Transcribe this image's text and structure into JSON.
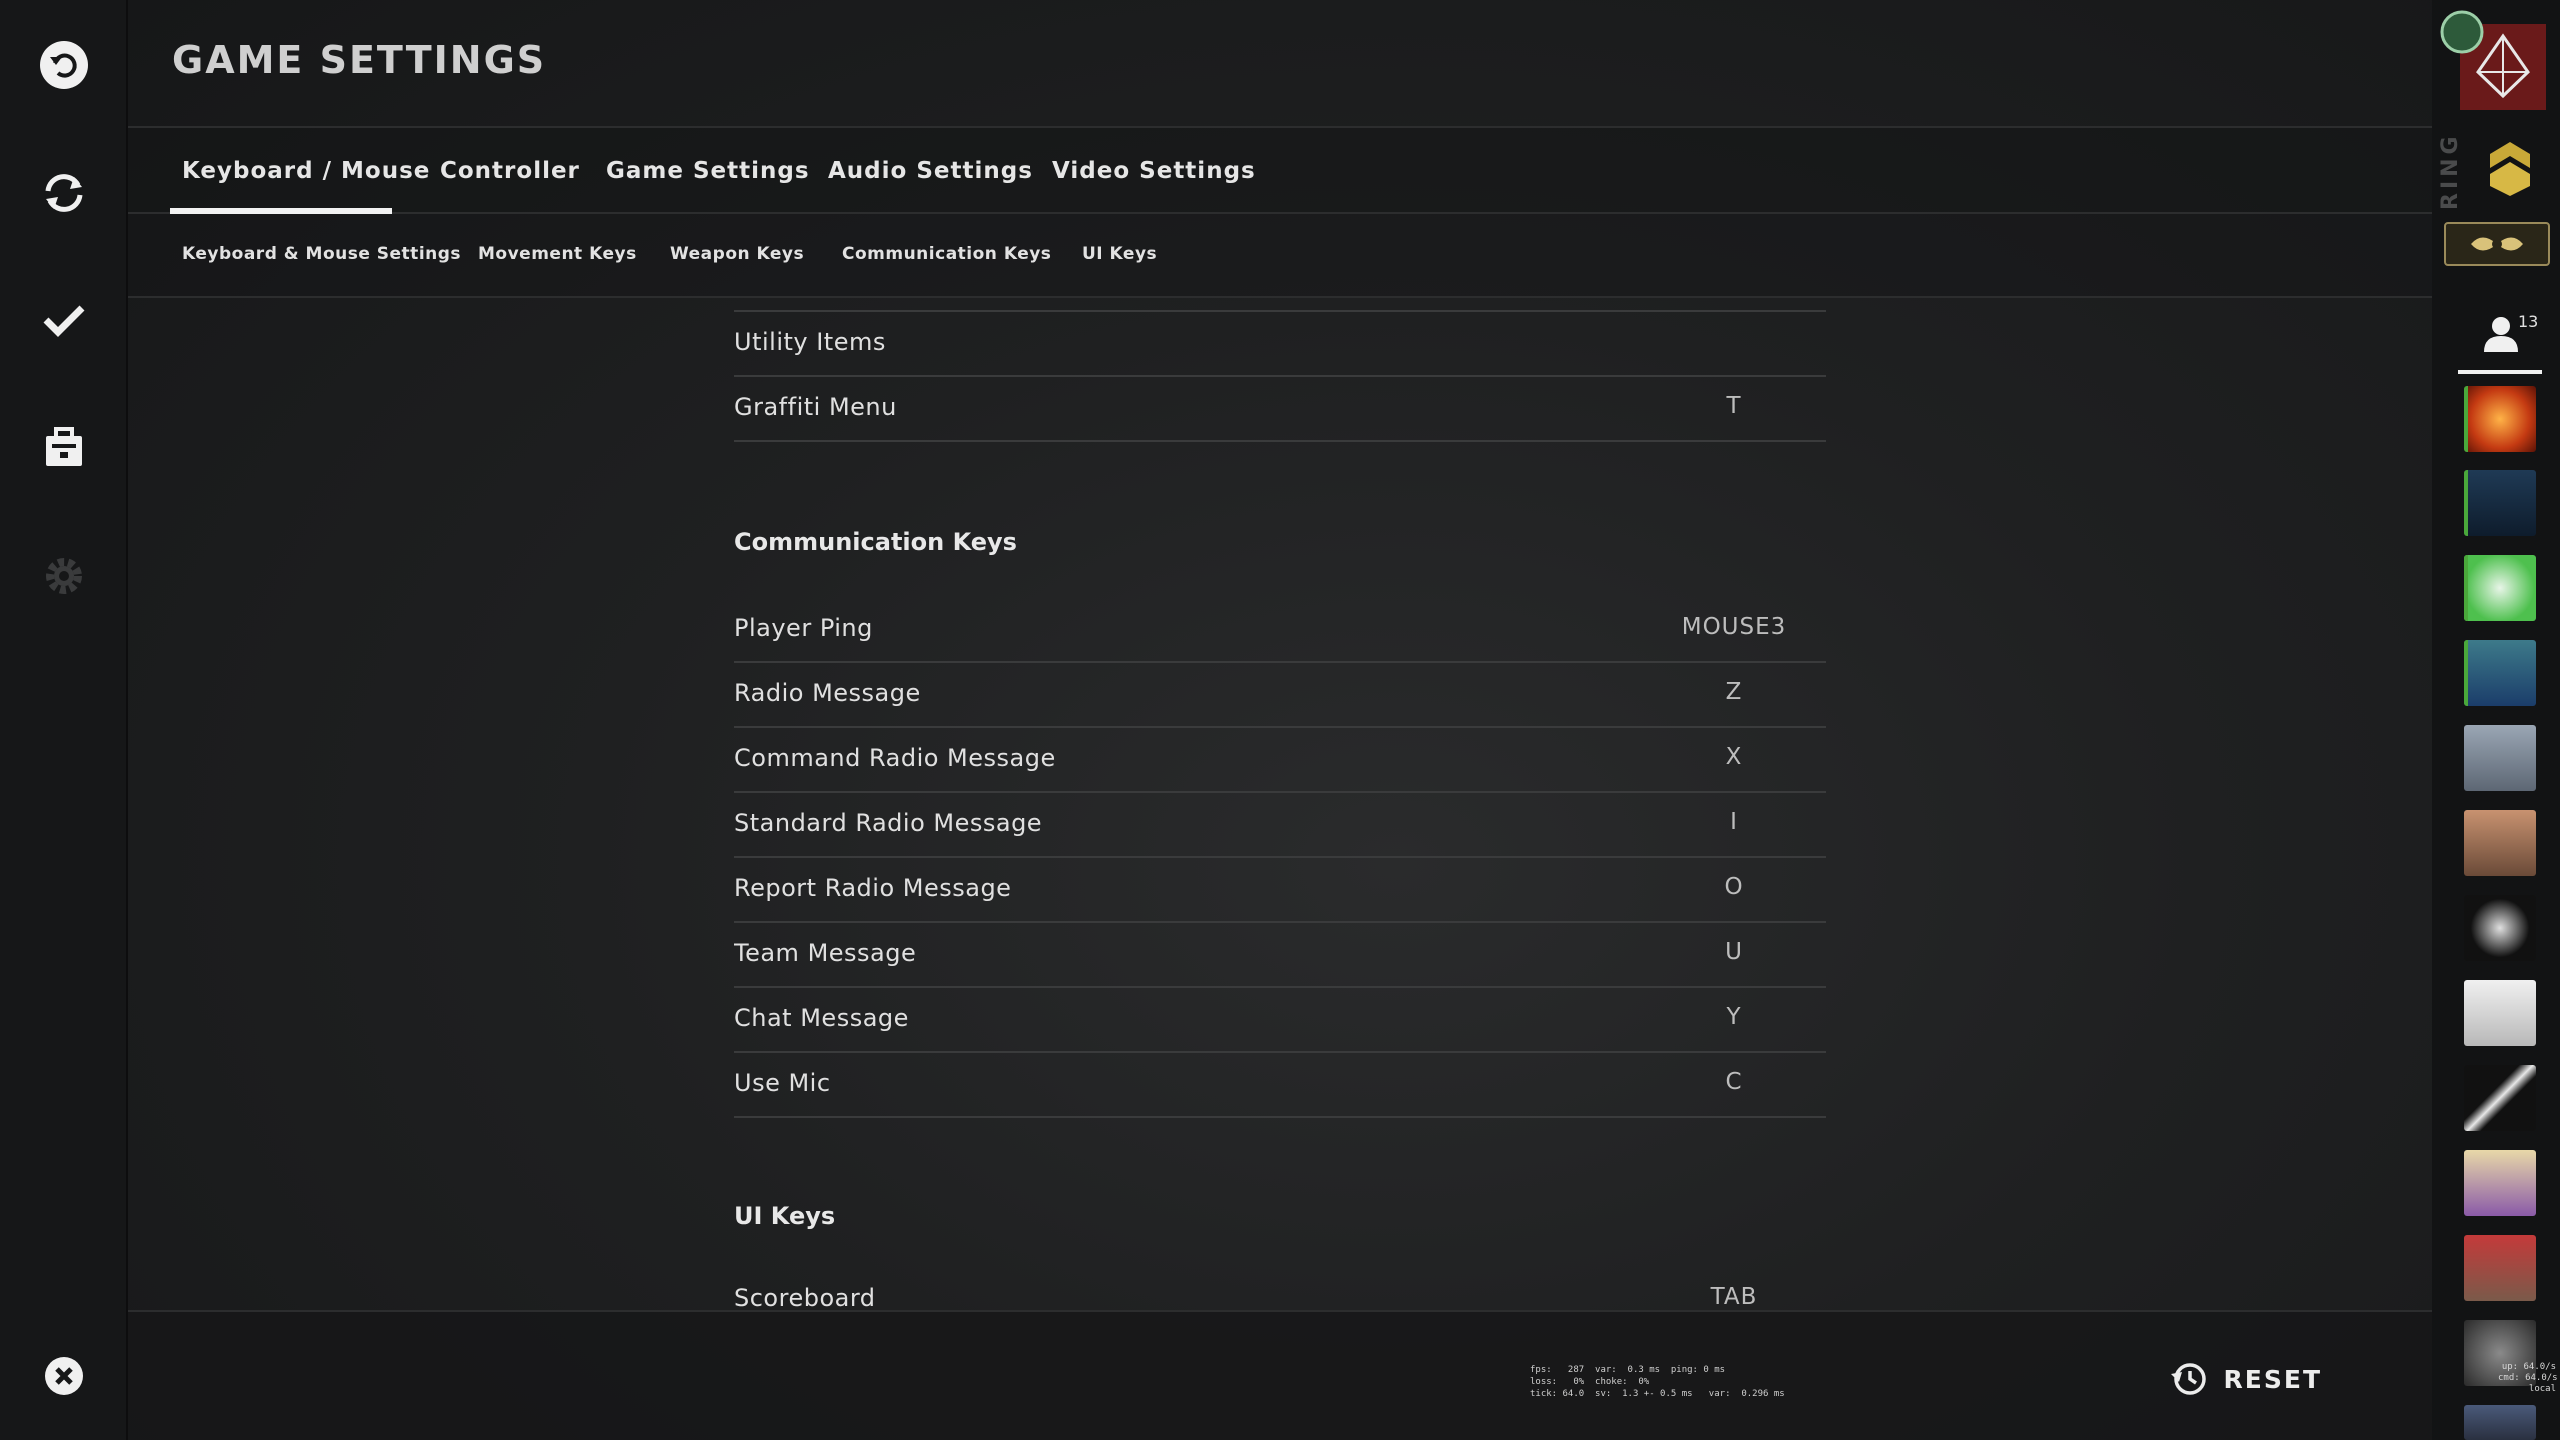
{
  "header": {
    "title": "GAME SETTINGS"
  },
  "left_nav": {
    "items": [
      {
        "name": "back-icon"
      },
      {
        "name": "refresh-icon"
      },
      {
        "name": "checkmark-icon"
      },
      {
        "name": "inventory-icon"
      },
      {
        "name": "settings-gear-icon"
      }
    ],
    "quit": {
      "name": "close-icon"
    }
  },
  "tabs": [
    {
      "label": "Keyboard / Mouse",
      "active": true
    },
    {
      "label": "Controller"
    },
    {
      "label": "Game Settings"
    },
    {
      "label": "Audio Settings"
    },
    {
      "label": "Video Settings"
    }
  ],
  "subtabs": [
    {
      "label": "Keyboard & Mouse Settings"
    },
    {
      "label": "Movement Keys"
    },
    {
      "label": "Weapon Keys"
    },
    {
      "label": "Communication Keys"
    },
    {
      "label": "UI Keys"
    }
  ],
  "rows_top": [
    {
      "label": "Utility Items",
      "key": ""
    },
    {
      "label": "Graffiti Menu",
      "key": "T"
    }
  ],
  "sections": {
    "communication": {
      "title": "Communication Keys",
      "rows": [
        {
          "label": "Player Ping",
          "key": "MOUSE3"
        },
        {
          "label": "Radio Message",
          "key": "Z"
        },
        {
          "label": "Command Radio Message",
          "key": "X"
        },
        {
          "label": "Standard Radio Message",
          "key": "I"
        },
        {
          "label": "Report Radio Message",
          "key": "O"
        },
        {
          "label": "Team Message",
          "key": "U"
        },
        {
          "label": "Chat Message",
          "key": "Y"
        },
        {
          "label": "Use Mic",
          "key": "C"
        }
      ]
    },
    "ui": {
      "title": "UI Keys",
      "rows": [
        {
          "label": "Scoreboard",
          "key": "TAB"
        }
      ]
    }
  },
  "footer": {
    "reset_label": "RESET",
    "netgraph": "fps:   287  var:  0.3 ms  ping: 0 ms\nloss:   0%  choke:  0%\ntick: 64.0  sv:  1.3 +- 0.5 ms   var:  0.296 ms"
  },
  "right_sidebar": {
    "vertical_text": "RING",
    "friends_count": "13",
    "overlay_text": "up: 64.0/s\ncmd: 64.0/s\nlocal",
    "colors": {
      "online_status": "#4aa83b",
      "rank_gold": "#c9a938"
    }
  }
}
